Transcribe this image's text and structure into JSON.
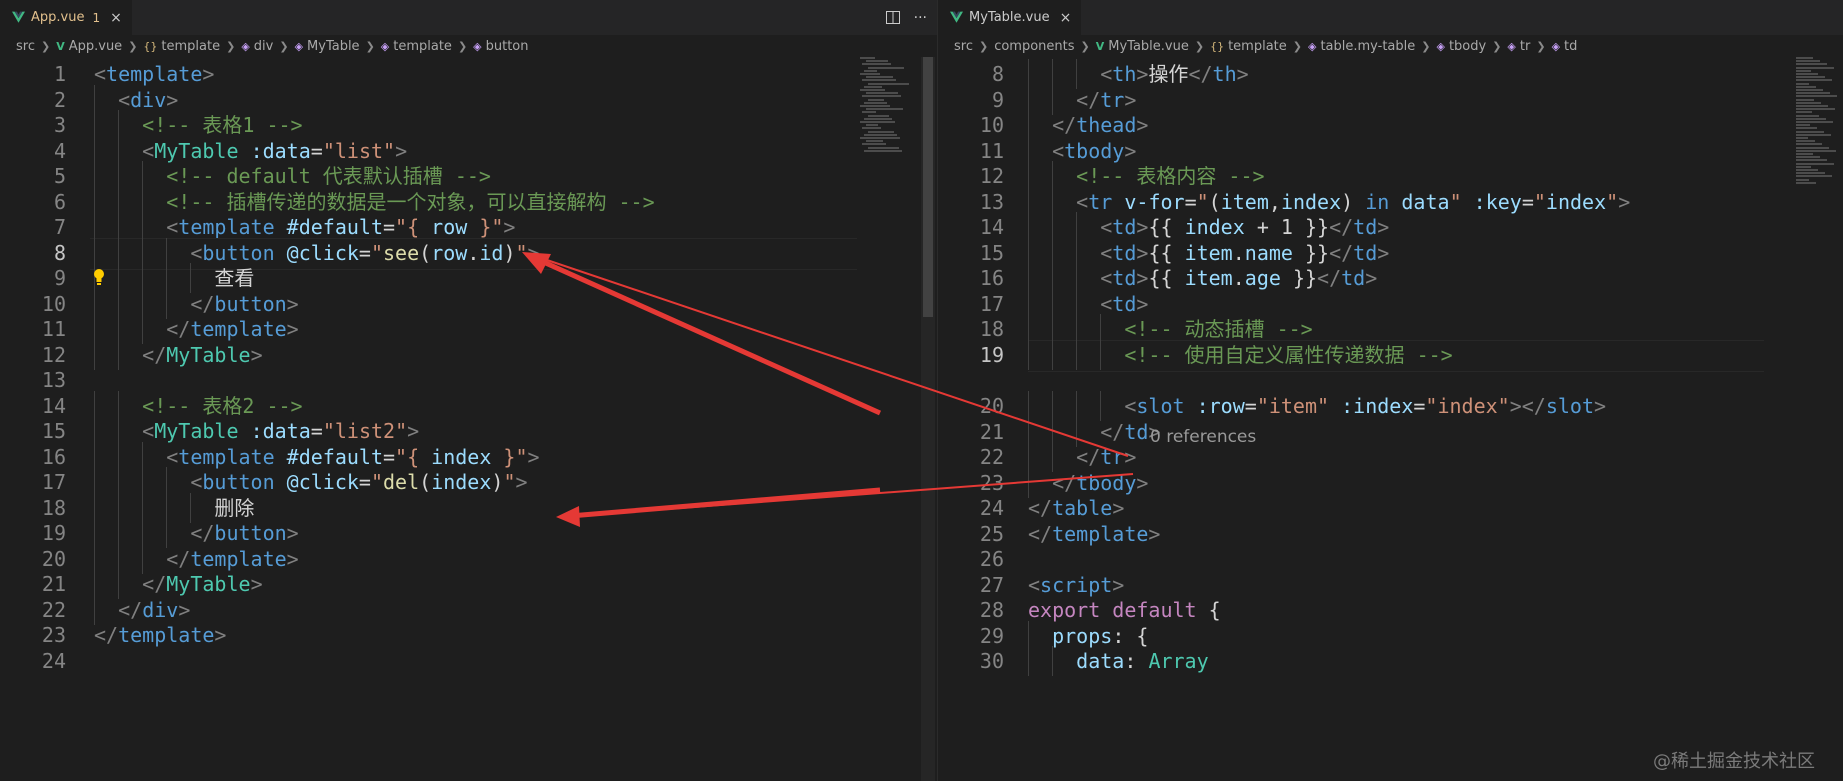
{
  "left": {
    "tab": {
      "title": "App.vue",
      "badge": "1",
      "close": "×"
    },
    "actions": [
      "split-editor",
      "more"
    ],
    "actions_glyphs": {
      "more": "···"
    },
    "breadcrumb": [
      "src",
      "App.vue",
      "template",
      "div",
      "MyTable",
      "template",
      "button"
    ],
    "lines": [
      {
        "n": "1",
        "t": [
          [
            "t-punct",
            "<"
          ],
          [
            "t-tag",
            "template"
          ],
          [
            "t-punct",
            ">"
          ]
        ]
      },
      {
        "n": "2",
        "t": [
          [
            "t-text",
            "  "
          ],
          [
            "t-punct",
            "<"
          ],
          [
            "t-tag",
            "div"
          ],
          [
            "t-punct",
            ">"
          ]
        ]
      },
      {
        "n": "3",
        "t": [
          [
            "t-text",
            "    "
          ],
          [
            "t-cmt",
            "<!-- 表格1 -->"
          ]
        ]
      },
      {
        "n": "4",
        "t": [
          [
            "t-text",
            "    "
          ],
          [
            "t-punct",
            "<"
          ],
          [
            "t-comp",
            "MyTable"
          ],
          [
            "t-text",
            " "
          ],
          [
            "t-attr",
            ":data"
          ],
          [
            "t-text",
            "="
          ],
          [
            "t-str",
            "\"list\""
          ],
          [
            "t-punct",
            ">"
          ]
        ]
      },
      {
        "n": "5",
        "t": [
          [
            "t-text",
            "      "
          ],
          [
            "t-cmt",
            "<!-- default 代表默认插槽 -->"
          ]
        ]
      },
      {
        "n": "6",
        "t": [
          [
            "t-text",
            "      "
          ],
          [
            "t-cmt",
            "<!-- 插槽传递的数据是一个对象，可以直接解构 -->"
          ]
        ]
      },
      {
        "n": "7",
        "t": [
          [
            "t-text",
            "      "
          ],
          [
            "t-punct",
            "<"
          ],
          [
            "t-tag",
            "template"
          ],
          [
            "t-text",
            " "
          ],
          [
            "t-attr",
            "#default"
          ],
          [
            "t-text",
            "="
          ],
          [
            "t-str",
            "\"{ "
          ],
          [
            "t-var",
            "row"
          ],
          [
            "t-str",
            " }\""
          ],
          [
            "t-punct",
            ">"
          ]
        ]
      },
      {
        "n": "8",
        "t": [
          [
            "t-text",
            "        "
          ],
          [
            "t-punct",
            "<"
          ],
          [
            "t-tag",
            "button"
          ],
          [
            "t-text",
            " "
          ],
          [
            "t-attr",
            "@click"
          ],
          [
            "t-text",
            "="
          ],
          [
            "t-str",
            "\""
          ],
          [
            "t-fn",
            "see"
          ],
          [
            "t-text",
            "("
          ],
          [
            "t-var",
            "row"
          ],
          [
            "t-text",
            "."
          ],
          [
            "t-var",
            "id"
          ],
          [
            "t-text",
            ")"
          ],
          [
            "t-str",
            "\""
          ],
          [
            "t-punct",
            ">"
          ]
        ]
      },
      {
        "n": "9",
        "t": [
          [
            "t-text",
            "          查看"
          ]
        ]
      },
      {
        "n": "10",
        "t": [
          [
            "t-text",
            "        "
          ],
          [
            "t-punct",
            "</"
          ],
          [
            "t-tag",
            "button"
          ],
          [
            "t-punct",
            ">"
          ]
        ]
      },
      {
        "n": "11",
        "t": [
          [
            "t-text",
            "      "
          ],
          [
            "t-punct",
            "</"
          ],
          [
            "t-tag",
            "template"
          ],
          [
            "t-punct",
            ">"
          ]
        ]
      },
      {
        "n": "12",
        "t": [
          [
            "t-text",
            "    "
          ],
          [
            "t-punct",
            "</"
          ],
          [
            "t-comp",
            "MyTable"
          ],
          [
            "t-punct",
            ">"
          ]
        ]
      },
      {
        "n": "13",
        "t": []
      },
      {
        "n": "14",
        "t": [
          [
            "t-text",
            "    "
          ],
          [
            "t-cmt",
            "<!-- 表格2 -->"
          ]
        ]
      },
      {
        "n": "15",
        "t": [
          [
            "t-text",
            "    "
          ],
          [
            "t-punct",
            "<"
          ],
          [
            "t-comp",
            "MyTable"
          ],
          [
            "t-text",
            " "
          ],
          [
            "t-attr",
            ":data"
          ],
          [
            "t-text",
            "="
          ],
          [
            "t-str",
            "\"list2\""
          ],
          [
            "t-punct",
            ">"
          ]
        ]
      },
      {
        "n": "16",
        "t": [
          [
            "t-text",
            "      "
          ],
          [
            "t-punct",
            "<"
          ],
          [
            "t-tag",
            "template"
          ],
          [
            "t-text",
            " "
          ],
          [
            "t-attr",
            "#default"
          ],
          [
            "t-text",
            "="
          ],
          [
            "t-str",
            "\"{ "
          ],
          [
            "t-var",
            "index"
          ],
          [
            "t-str",
            " }\""
          ],
          [
            "t-punct",
            ">"
          ]
        ]
      },
      {
        "n": "17",
        "t": [
          [
            "t-text",
            "        "
          ],
          [
            "t-punct",
            "<"
          ],
          [
            "t-tag",
            "button"
          ],
          [
            "t-text",
            " "
          ],
          [
            "t-attr",
            "@click"
          ],
          [
            "t-text",
            "="
          ],
          [
            "t-str",
            "\""
          ],
          [
            "t-fn",
            "del"
          ],
          [
            "t-text",
            "("
          ],
          [
            "t-var",
            "index"
          ],
          [
            "t-text",
            ")"
          ],
          [
            "t-str",
            "\""
          ],
          [
            "t-punct",
            ">"
          ]
        ]
      },
      {
        "n": "18",
        "t": [
          [
            "t-text",
            "          删除"
          ]
        ]
      },
      {
        "n": "19",
        "t": [
          [
            "t-text",
            "        "
          ],
          [
            "t-punct",
            "</"
          ],
          [
            "t-tag",
            "button"
          ],
          [
            "t-punct",
            ">"
          ]
        ]
      },
      {
        "n": "20",
        "t": [
          [
            "t-text",
            "      "
          ],
          [
            "t-punct",
            "</"
          ],
          [
            "t-tag",
            "template"
          ],
          [
            "t-punct",
            ">"
          ]
        ]
      },
      {
        "n": "21",
        "t": [
          [
            "t-text",
            "    "
          ],
          [
            "t-punct",
            "</"
          ],
          [
            "t-comp",
            "MyTable"
          ],
          [
            "t-punct",
            ">"
          ]
        ]
      },
      {
        "n": "22",
        "t": [
          [
            "t-text",
            "  "
          ],
          [
            "t-punct",
            "</"
          ],
          [
            "t-tag",
            "div"
          ],
          [
            "t-punct",
            ">"
          ]
        ]
      },
      {
        "n": "23",
        "t": [
          [
            "t-punct",
            "</"
          ],
          [
            "t-tag",
            "template"
          ],
          [
            "t-punct",
            ">"
          ]
        ]
      },
      {
        "n": "24",
        "t": []
      }
    ],
    "current_line": "8"
  },
  "right": {
    "tab": {
      "title": "MyTable.vue",
      "close": "×"
    },
    "breadcrumb": [
      "src",
      "components",
      "MyTable.vue",
      "template",
      "table.my-table",
      "tbody",
      "tr",
      "td"
    ],
    "lines": [
      {
        "n": "8",
        "t": [
          [
            "t-text",
            "      "
          ],
          [
            "t-punct",
            "<"
          ],
          [
            "t-tag",
            "th"
          ],
          [
            "t-punct",
            ">"
          ],
          [
            "t-text",
            "操作"
          ],
          [
            "t-punct",
            "</"
          ],
          [
            "t-tag",
            "th"
          ],
          [
            "t-punct",
            ">"
          ]
        ]
      },
      {
        "n": "9",
        "t": [
          [
            "t-text",
            "    "
          ],
          [
            "t-punct",
            "</"
          ],
          [
            "t-tag",
            "tr"
          ],
          [
            "t-punct",
            ">"
          ]
        ]
      },
      {
        "n": "10",
        "t": [
          [
            "t-text",
            "  "
          ],
          [
            "t-punct",
            "</"
          ],
          [
            "t-tag",
            "thead"
          ],
          [
            "t-punct",
            ">"
          ]
        ]
      },
      {
        "n": "11",
        "t": [
          [
            "t-text",
            "  "
          ],
          [
            "t-punct",
            "<"
          ],
          [
            "t-tag",
            "tbody"
          ],
          [
            "t-punct",
            ">"
          ]
        ]
      },
      {
        "n": "12",
        "t": [
          [
            "t-text",
            "    "
          ],
          [
            "t-cmt",
            "<!-- 表格内容 -->"
          ]
        ]
      },
      {
        "n": "13",
        "t": [
          [
            "t-text",
            "    "
          ],
          [
            "t-punct",
            "<"
          ],
          [
            "t-tag",
            "tr"
          ],
          [
            "t-text",
            " "
          ],
          [
            "t-attr",
            "v-for"
          ],
          [
            "t-text",
            "="
          ],
          [
            "t-str",
            "\""
          ],
          [
            "t-text",
            "("
          ],
          [
            "t-var",
            "item"
          ],
          [
            "t-text",
            ","
          ],
          [
            "t-var",
            "index"
          ],
          [
            "t-text",
            ") "
          ],
          [
            "t-kw2",
            "in"
          ],
          [
            "t-text",
            " "
          ],
          [
            "t-var",
            "data"
          ],
          [
            "t-str",
            "\""
          ],
          [
            "t-text",
            " "
          ],
          [
            "t-attr",
            ":key"
          ],
          [
            "t-text",
            "="
          ],
          [
            "t-str",
            "\""
          ],
          [
            "t-var",
            "index"
          ],
          [
            "t-str",
            "\""
          ],
          [
            "t-punct",
            ">"
          ]
        ]
      },
      {
        "n": "14",
        "t": [
          [
            "t-text",
            "      "
          ],
          [
            "t-punct",
            "<"
          ],
          [
            "t-tag",
            "td"
          ],
          [
            "t-punct",
            ">"
          ],
          [
            "t-br",
            "{{ "
          ],
          [
            "t-var",
            "index"
          ],
          [
            "t-text",
            " + "
          ],
          [
            "t-text",
            "1"
          ],
          [
            "t-br",
            " }}"
          ],
          [
            "t-punct",
            "</"
          ],
          [
            "t-tag",
            "td"
          ],
          [
            "t-punct",
            ">"
          ]
        ]
      },
      {
        "n": "15",
        "t": [
          [
            "t-text",
            "      "
          ],
          [
            "t-punct",
            "<"
          ],
          [
            "t-tag",
            "td"
          ],
          [
            "t-punct",
            ">"
          ],
          [
            "t-br",
            "{{ "
          ],
          [
            "t-var",
            "item"
          ],
          [
            "t-text",
            "."
          ],
          [
            "t-var",
            "name"
          ],
          [
            "t-br",
            " }}"
          ],
          [
            "t-punct",
            "</"
          ],
          [
            "t-tag",
            "td"
          ],
          [
            "t-punct",
            ">"
          ]
        ]
      },
      {
        "n": "16",
        "t": [
          [
            "t-text",
            "      "
          ],
          [
            "t-punct",
            "<"
          ],
          [
            "t-tag",
            "td"
          ],
          [
            "t-punct",
            ">"
          ],
          [
            "t-br",
            "{{ "
          ],
          [
            "t-var",
            "item"
          ],
          [
            "t-text",
            "."
          ],
          [
            "t-var",
            "age"
          ],
          [
            "t-br",
            " }}"
          ],
          [
            "t-punct",
            "</"
          ],
          [
            "t-tag",
            "td"
          ],
          [
            "t-punct",
            ">"
          ]
        ]
      },
      {
        "n": "17",
        "t": [
          [
            "t-text",
            "      "
          ],
          [
            "t-punct",
            "<"
          ],
          [
            "t-tag",
            "td"
          ],
          [
            "t-punct",
            ">"
          ]
        ]
      },
      {
        "n": "18",
        "t": [
          [
            "t-text",
            "        "
          ],
          [
            "t-cmt",
            "<!-- 动态插槽 -->"
          ]
        ]
      },
      {
        "n": "19",
        "t": [
          [
            "t-text",
            "        "
          ],
          [
            "t-cmt",
            "<!-- 使用自定义属性传递数据 -->"
          ]
        ]
      },
      {
        "n": "20",
        "t": [
          [
            "t-text",
            "        "
          ],
          [
            "t-punct",
            "<"
          ],
          [
            "t-tag",
            "slot"
          ],
          [
            "t-text",
            " "
          ],
          [
            "t-attr",
            ":row"
          ],
          [
            "t-text",
            "="
          ],
          [
            "t-str",
            "\"item\""
          ],
          [
            "t-text",
            " "
          ],
          [
            "t-attr",
            ":index"
          ],
          [
            "t-text",
            "="
          ],
          [
            "t-str",
            "\"index\""
          ],
          [
            "t-punct",
            "></"
          ],
          [
            "t-tag",
            "slot"
          ],
          [
            "t-punct",
            ">"
          ]
        ]
      },
      {
        "n": "21",
        "t": [
          [
            "t-text",
            "      "
          ],
          [
            "t-punct",
            "</"
          ],
          [
            "t-tag",
            "td"
          ],
          [
            "t-punct",
            ">"
          ]
        ]
      },
      {
        "n": "22",
        "t": [
          [
            "t-text",
            "    "
          ],
          [
            "t-punct",
            "</"
          ],
          [
            "t-tag",
            "tr"
          ],
          [
            "t-punct",
            ">"
          ]
        ]
      },
      {
        "n": "23",
        "t": [
          [
            "t-text",
            "  "
          ],
          [
            "t-punct",
            "</"
          ],
          [
            "t-tag",
            "tbody"
          ],
          [
            "t-punct",
            ">"
          ]
        ]
      },
      {
        "n": "24",
        "t": [
          [
            "t-punct",
            "</"
          ],
          [
            "t-tag",
            "table"
          ],
          [
            "t-punct",
            ">"
          ]
        ]
      },
      {
        "n": "25",
        "t": [
          [
            "t-punct",
            "</"
          ],
          [
            "t-tag",
            "template"
          ],
          [
            "t-punct",
            ">"
          ]
        ]
      },
      {
        "n": "26",
        "t": []
      },
      {
        "n": "27",
        "t": [
          [
            "t-punct",
            "<"
          ],
          [
            "t-tag",
            "script"
          ],
          [
            "t-punct",
            ">"
          ]
        ]
      },
      {
        "n": "28",
        "t": [
          [
            "t-kw",
            "export"
          ],
          [
            "t-text",
            " "
          ],
          [
            "t-kw",
            "default"
          ],
          [
            "t-text",
            " {"
          ]
        ]
      },
      {
        "n": "29",
        "t": [
          [
            "t-text",
            "  "
          ],
          [
            "t-var",
            "props"
          ],
          [
            "t-text",
            ": {"
          ]
        ]
      },
      {
        "n": "30",
        "t": [
          [
            "t-text",
            "    "
          ],
          [
            "t-var",
            "data"
          ],
          [
            "t-text",
            ": "
          ],
          [
            "t-comp",
            "Array"
          ]
        ]
      }
    ],
    "current_line": "19",
    "references_text": "0 references"
  },
  "watermark": "@稀土掘金技术社区",
  "colors": {
    "arrow": "#e53935",
    "bg": "#1e1e1e",
    "tab_modified": "#e2c08d"
  }
}
